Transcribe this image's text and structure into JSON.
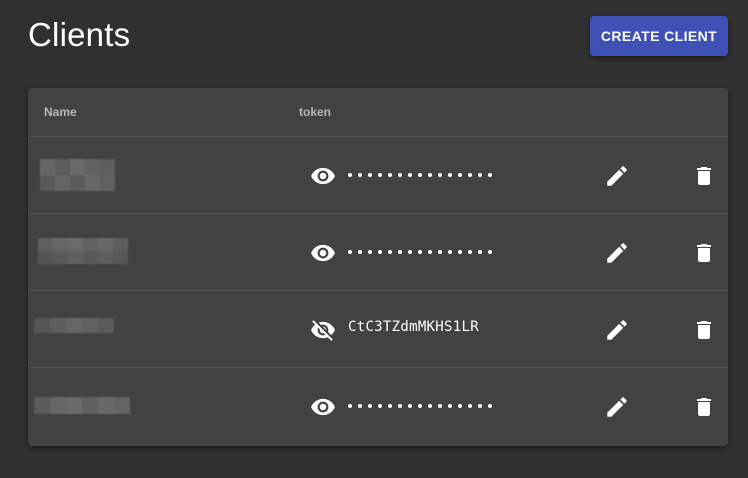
{
  "header": {
    "title": "Clients",
    "create_label": "CREATE CLIENT",
    "create_color": "#3f51b5"
  },
  "table": {
    "columns": [
      "Name",
      "token"
    ],
    "rows": [
      {
        "name": "",
        "name_redacted": true,
        "token_visible": false,
        "token": "",
        "visibility_icon": "eye-icon"
      },
      {
        "name": "",
        "name_redacted": true,
        "token_visible": false,
        "token": "",
        "visibility_icon": "eye-icon"
      },
      {
        "name": "",
        "name_redacted": true,
        "token_visible": true,
        "token": "CtC3TZdmMKHS1LR",
        "visibility_icon": "eye-off-icon"
      },
      {
        "name": "",
        "name_redacted": true,
        "token_visible": false,
        "token": "",
        "visibility_icon": "eye-icon"
      }
    ],
    "row_actions": [
      "pencil-icon",
      "trash-icon"
    ]
  },
  "colors": {
    "background": "#303030",
    "card": "#424242",
    "divider": "#555555",
    "header_text": "#b8b8b8"
  }
}
